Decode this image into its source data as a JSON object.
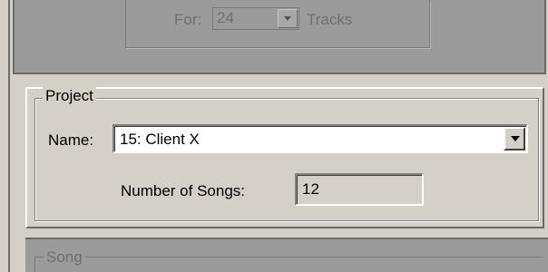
{
  "top_section": {
    "for_label": "For:",
    "tracks_value": "24",
    "tracks_label": "Tracks"
  },
  "project": {
    "group_title": "Project",
    "name_label": "Name:",
    "name_value": "15: Client X",
    "songs_label": "Number of Songs:",
    "songs_value": "12"
  },
  "song_section": {
    "group_title": "Song"
  },
  "colors": {
    "window_bg": "#d4d0c8",
    "disabled_bg": "#9b9b9b",
    "disabled_text": "#6f6f6f"
  }
}
